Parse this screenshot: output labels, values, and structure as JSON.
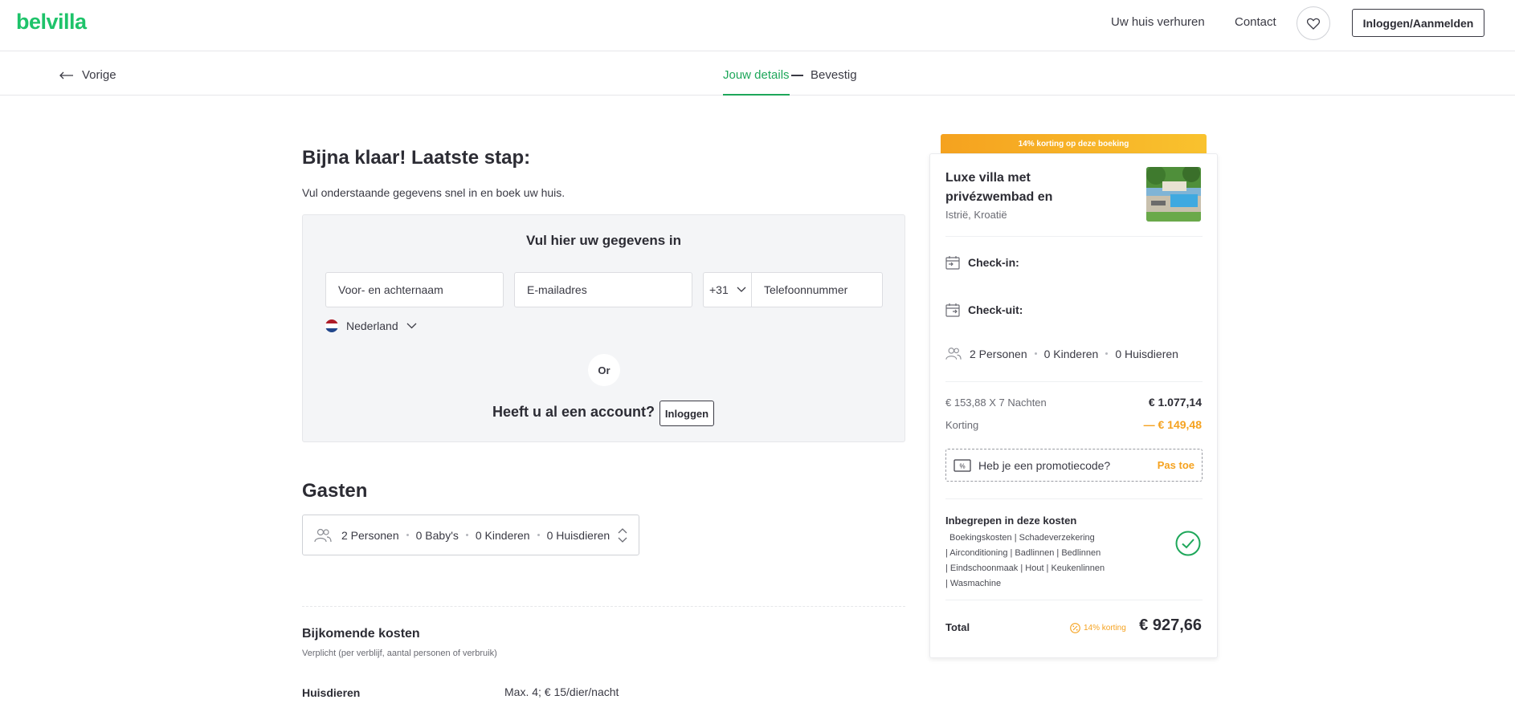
{
  "header": {
    "logo": "belvilla",
    "nav": [
      "Uw huis verhuren",
      "Contact"
    ],
    "login_label": "Inloggen/Aanmelden"
  },
  "steps": {
    "back_label": "Vorige",
    "active": "Jouw details",
    "next": "Bevestig"
  },
  "main": {
    "title": "Bijna klaar! Laatste stap:",
    "subtitle": "Vul onderstaande gegevens snel in en boek uw huis.",
    "form": {
      "title": "Vul hier uw gegevens in",
      "name_placeholder": "Voor- en achternaam",
      "email_placeholder": "E-mailadres",
      "phone_prefix": "+31",
      "phone_placeholder": "Telefoonnummer",
      "country": "Nederland",
      "or": "Or",
      "account_question": "Heeft u al een account?",
      "login_label": "Inloggen"
    },
    "guests": {
      "title": "Gasten",
      "persons": "2 Personen",
      "babies": "0 Baby's",
      "children": "0 Kinderen",
      "pets": "0 Huisdieren"
    },
    "costs": {
      "title": "Bijkomende kosten",
      "subtitle": "Verplicht (per verblijf, aantal personen of verbruik)",
      "row_label": "Huisdieren",
      "row_value": "Max. 4; € 15/dier/nacht"
    }
  },
  "sidebar": {
    "discount_banner": "14% korting op deze boeking",
    "villa_title": "Luxe villa met privézwembad en",
    "villa_location": "Istrië, Kroatië",
    "checkin_label": "Check-in:",
    "checkout_label": "Check-uit:",
    "persons": "2 Personen",
    "children": "0 Kinderen",
    "pets": "0 Huisdieren",
    "price_line": "€ 153,88 X 7 Nachten",
    "price_value": "€ 1.077,14",
    "discount_label": "Korting",
    "discount_value": "— € 149,48",
    "promo_placeholder": "Heb je een promotiecode?",
    "promo_apply": "Pas toe",
    "included_title": "Inbegrepen in deze kosten",
    "included_lines": [
      "Boekingskosten | Schadeverzekering",
      "| Airconditioning | Badlinnen | Bedlinnen",
      "| Eindschoonmaak | Hout | Keukenlinnen",
      "| Wasmachine"
    ],
    "total_label": "Total",
    "total_discount": "14% korting",
    "total_amount": "€ 927,66"
  },
  "colors": {
    "brand_green": "#1ec36a",
    "accent_orange": "#f5a21f"
  }
}
